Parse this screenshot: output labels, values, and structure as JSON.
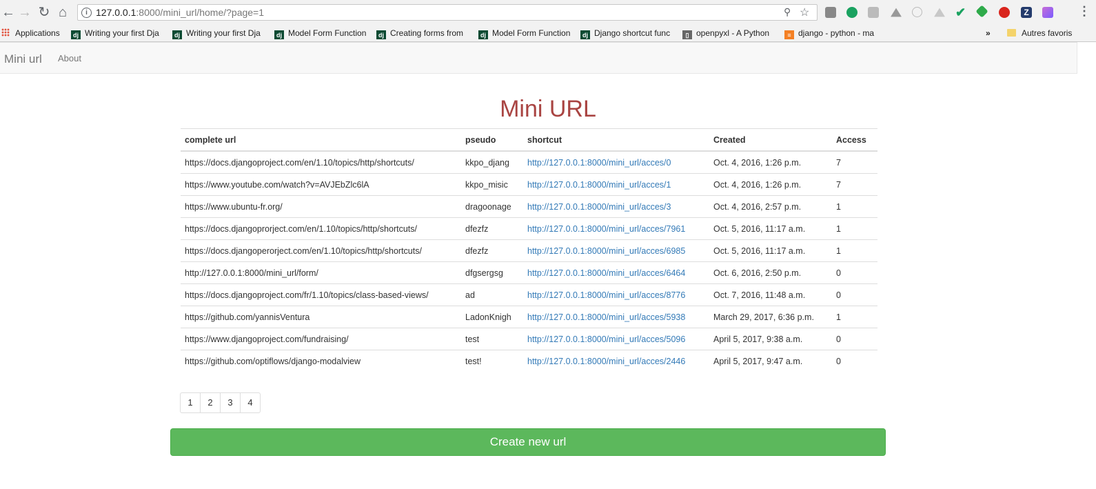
{
  "browser": {
    "url_host": "127.0.0.1",
    "url_rest": ":8000/mini_url/home/?page=1",
    "bookmarks": [
      "Applications",
      "Writing your first Dja",
      "Writing your first Dja",
      "Model Form Function",
      "Creating forms from",
      "Model Form Function",
      "Django shortcut func",
      "openpyxl - A Python",
      "django - python - ma"
    ],
    "bookmarks_overflow": "»",
    "other_bookmarks": "Autres favoris"
  },
  "navbar": {
    "brand": "Mini url",
    "about": "About"
  },
  "page": {
    "title": "Mini URL",
    "columns": [
      "complete url",
      "pseudo",
      "shortcut",
      "Created",
      "Access"
    ],
    "rows": [
      [
        "https://docs.djangoproject.com/en/1.10/topics/http/shortcuts/",
        "kkpo_djang",
        "http://127.0.0.1:8000/mini_url/acces/0",
        "Oct. 4, 2016, 1:26 p.m.",
        "7"
      ],
      [
        "https://www.youtube.com/watch?v=AVJEbZlc6lA",
        "kkpo_misic",
        "http://127.0.0.1:8000/mini_url/acces/1",
        "Oct. 4, 2016, 1:26 p.m.",
        "7"
      ],
      [
        "https://www.ubuntu-fr.org/",
        "dragoonage",
        "http://127.0.0.1:8000/mini_url/acces/3",
        "Oct. 4, 2016, 2:57 p.m.",
        "1"
      ],
      [
        "https://docs.djangoprorject.com/en/1.10/topics/http/shortcuts/",
        "dfezfz",
        "http://127.0.0.1:8000/mini_url/acces/7961",
        "Oct. 5, 2016, 11:17 a.m.",
        "1"
      ],
      [
        "https://docs.djangoperorject.com/en/1.10/topics/http/shortcuts/",
        "dfezfz",
        "http://127.0.0.1:8000/mini_url/acces/6985",
        "Oct. 5, 2016, 11:17 a.m.",
        "1"
      ],
      [
        "http://127.0.0.1:8000/mini_url/form/",
        "dfgsergsg",
        "http://127.0.0.1:8000/mini_url/acces/6464",
        "Oct. 6, 2016, 2:50 p.m.",
        "0"
      ],
      [
        "https://docs.djangoproject.com/fr/1.10/topics/class-based-views/",
        "ad",
        "http://127.0.0.1:8000/mini_url/acces/8776",
        "Oct. 7, 2016, 11:48 a.m.",
        "0"
      ],
      [
        "https://github.com/yannisVentura",
        "LadonKnigh",
        "http://127.0.0.1:8000/mini_url/acces/5938",
        "March 29, 2017, 6:36 p.m.",
        "1"
      ],
      [
        "https://www.djangoproject.com/fundraising/",
        "test",
        "http://127.0.0.1:8000/mini_url/acces/5096",
        "April 5, 2017, 9:38 a.m.",
        "0"
      ],
      [
        "https://github.com/optiflows/django-modalview",
        "test!",
        "http://127.0.0.1:8000/mini_url/acces/2446",
        "April 5, 2017, 9:47 a.m.",
        "0"
      ]
    ],
    "pages": [
      "1",
      "2",
      "3",
      "4"
    ],
    "create_button": "Create new url"
  }
}
